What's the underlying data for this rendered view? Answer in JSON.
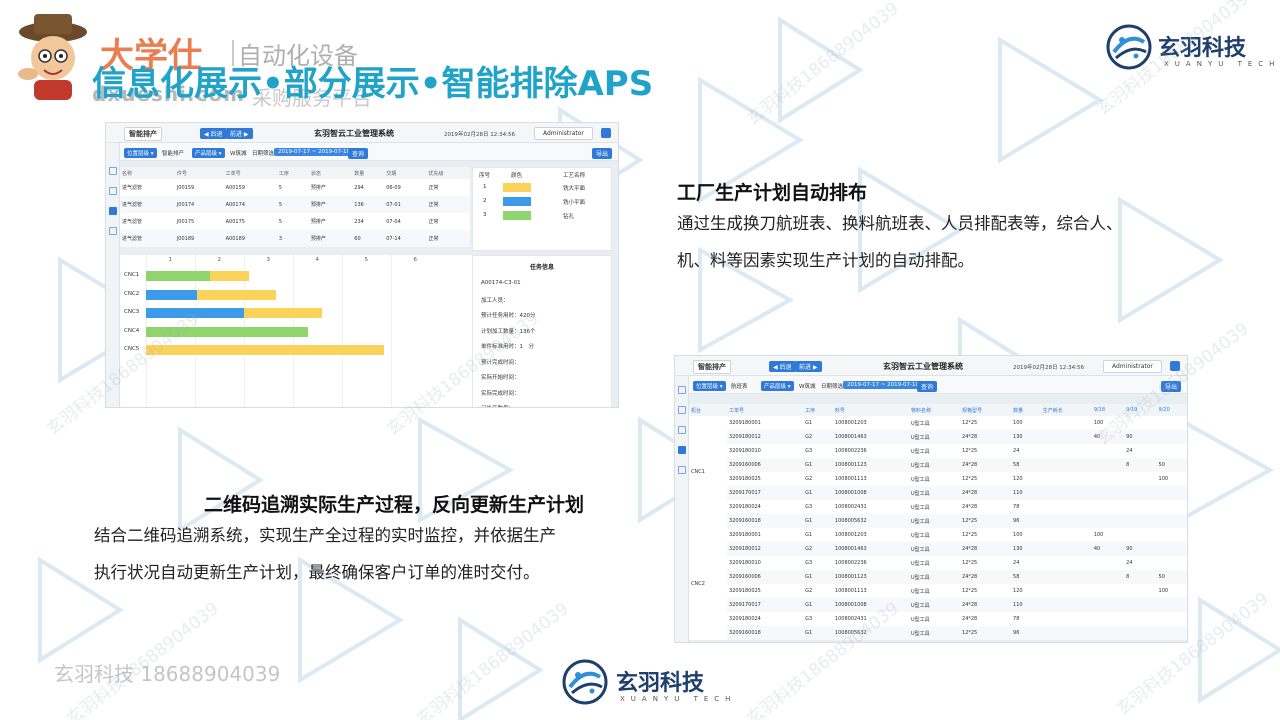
{
  "header": {
    "brand_name": "大学仕",
    "brand_sub": "自动化设备",
    "brand_url": "dxueshi.com",
    "brand_url_sub": "采购服务平台",
    "title": "信息化展示•部分展示•智能排除APS"
  },
  "logo": {
    "name": "玄羽科技",
    "sub": "XUANYU TECH",
    "primary_color": "#1e3f6d",
    "accent_color": "#2f8fd8"
  },
  "accent_color": "#1fa3c9",
  "screen1": {
    "menu_label": "智能排产",
    "nav_prev": "◀ 后退",
    "nav_next": "前进 ▶",
    "app_title": "玄羽智云工业管理系统",
    "datetime": "2019年02月28日  12:34:56",
    "user": "Administrator",
    "filter_dropdown": "位置层级 ▾",
    "breadcrumb_1": "智能排产",
    "filter_product": "产品层级 ▾",
    "filter_w": "W筑城",
    "date_label": "日期筛选",
    "date_range": "2019-07-17 ~ 2019-07-18",
    "query_btn": "查询",
    "export_btn": "导出",
    "table_headers": [
      "名称",
      "件号",
      "工单号",
      "工序",
      "状态",
      "数量",
      "交期",
      "优先级"
    ],
    "table_rows": [
      [
        "进气滤管",
        "J00159",
        "A00159",
        "5",
        "预排产",
        "294",
        "06-09",
        "正常"
      ],
      [
        "进气滤管",
        "J00174",
        "A00174",
        "5",
        "预排产",
        "136",
        "07-01",
        "正常"
      ],
      [
        "进气滤管",
        "J00175",
        "A00175",
        "5",
        "预排产",
        "234",
        "07-04",
        "正常"
      ],
      [
        "进气滤管",
        "J00189",
        "A00189",
        "3",
        "预排产",
        "60",
        "07-14",
        "正常"
      ]
    ],
    "legend_headers": [
      "序号",
      "颜色",
      "工艺名称"
    ],
    "legend_rows": [
      {
        "no": "1",
        "color": "#fbd35a",
        "name": "铣大平面"
      },
      {
        "no": "2",
        "color": "#3d9be9",
        "name": "铣小平面"
      },
      {
        "no": "3",
        "color": "#8fd46c",
        "name": "钻孔"
      }
    ],
    "gantt_ticks": [
      "1",
      "2",
      "3",
      "4",
      "5",
      "6"
    ],
    "gantt_rows": [
      {
        "label": "CNC1",
        "segments": [
          {
            "start": 0,
            "len": 1.3,
            "color": "#8fd46c"
          },
          {
            "start": 1.3,
            "len": 0.8,
            "color": "#fbd35a"
          }
        ]
      },
      {
        "label": "CNC2",
        "segments": [
          {
            "start": 0,
            "len": 1.05,
            "color": "#3d9be9"
          },
          {
            "start": 1.05,
            "len": 1.6,
            "color": "#fbd35a"
          }
        ]
      },
      {
        "label": "CNC3",
        "segments": [
          {
            "start": 0,
            "len": 2.0,
            "color": "#3d9be9"
          },
          {
            "start": 2.0,
            "len": 1.6,
            "color": "#fbd35a"
          }
        ]
      },
      {
        "label": "CNC4",
        "segments": [
          {
            "start": 0,
            "len": 3.3,
            "color": "#8fd46c"
          }
        ]
      },
      {
        "label": "CNC5",
        "segments": [
          {
            "start": 0,
            "len": 4.85,
            "color": "#fbd35a"
          }
        ]
      }
    ],
    "task_title": "任务信息",
    "task_lines": [
      "A00174-C3-01",
      "加工人员：",
      "预计任务用时：420分",
      "计划加工数量：136个",
      "单件标准用时：1　分",
      "预计完成时间：",
      "实际开始时间：",
      "实际完成时间：",
      "已生产数量："
    ]
  },
  "screen2": {
    "menu_label": "智能排产",
    "nav_prev": "◀ 后退",
    "nav_next": "前进 ▶",
    "app_title": "玄羽智云工业管理系统",
    "datetime": "2019年02月28日  12:34:56",
    "user": "Administrator",
    "filter_dropdown": "位置层级 ▾",
    "breadcrumb_1": "航班表",
    "filter_product": "产品层级 ▾",
    "filter_w": "W筑城",
    "date_label": "日期筛选",
    "date_range": "2019-07-17 ~ 2019-07-18",
    "query_btn": "查询",
    "export_btn": "导出",
    "table_headers": [
      "机台",
      "工单号",
      "工序",
      "料号",
      "物料名称",
      "规格型号",
      "数量",
      "生产耗长",
      "9/18",
      "9/19",
      "9/20"
    ],
    "machines": [
      "CNC1",
      "CNC2"
    ],
    "rows": [
      [
        "3209180001",
        "G1",
        "1008001203",
        "U型工具",
        "12*25",
        "100",
        "",
        "100",
        "",
        ""
      ],
      [
        "3209180012",
        "G2",
        "1008001463",
        "U型工具",
        "24*28",
        "130",
        "",
        "40",
        "90",
        ""
      ],
      [
        "3209180010",
        "G3",
        "1008002236",
        "U型工具",
        "12*25",
        "24",
        "",
        "",
        "24",
        ""
      ],
      [
        "3209160006",
        "G1",
        "1008001123",
        "U型工具",
        "24*28",
        "58",
        "",
        "",
        "8",
        "50"
      ],
      [
        "3209180025",
        "G2",
        "1008001113",
        "U型工具",
        "12*25",
        "120",
        "",
        "",
        "",
        "100"
      ],
      [
        "3209170017",
        "G1",
        "1008001008",
        "U型工具",
        "24*28",
        "110",
        "",
        "",
        "",
        ""
      ],
      [
        "3209180024",
        "G3",
        "1008002431",
        "U型工具",
        "24*28",
        "78",
        "",
        "",
        "",
        ""
      ],
      [
        "3209160018",
        "G1",
        "1008005632",
        "U型工具",
        "12*25",
        "96",
        "",
        "",
        "",
        ""
      ],
      [
        "3209180001",
        "G1",
        "1008001203",
        "U型工具",
        "12*25",
        "100",
        "",
        "100",
        "",
        ""
      ],
      [
        "3209180012",
        "G2",
        "1008001463",
        "U型工具",
        "24*28",
        "130",
        "",
        "40",
        "90",
        ""
      ],
      [
        "3209180010",
        "G3",
        "1008002236",
        "U型工具",
        "12*25",
        "24",
        "",
        "",
        "24",
        ""
      ],
      [
        "3209160006",
        "G1",
        "1008001123",
        "U型工具",
        "24*28",
        "58",
        "",
        "",
        "8",
        "50"
      ],
      [
        "3209180025",
        "G2",
        "1008001113",
        "U型工具",
        "12*25",
        "120",
        "",
        "",
        "",
        "100"
      ],
      [
        "3209170017",
        "G1",
        "1008001008",
        "U型工具",
        "24*28",
        "110",
        "",
        "",
        "",
        ""
      ],
      [
        "3209180024",
        "G3",
        "1008002431",
        "U型工具",
        "24*28",
        "78",
        "",
        "",
        "",
        ""
      ],
      [
        "3209160018",
        "G1",
        "1008005632",
        "U型工具",
        "12*25",
        "96",
        "",
        "",
        "",
        ""
      ]
    ]
  },
  "section1": {
    "title": "工厂生产计划自动排布",
    "line1": "通过生成换刀航班表、换料航班表、人员排配表等，综合人、",
    "line2": "机、料等因素实现生产计划的自动排配。"
  },
  "section2": {
    "title": "二维码追溯实际生产过程，反向更新生产计划",
    "line1": "结合二维码追溯系统，实现生产全过程的实时监控，并依据生产",
    "line2": "执行状况自动更新生产计划，最终确保客户订单的准时交付。"
  },
  "footer": {
    "watermark": "玄羽科技  18688904039"
  },
  "watermarks": [
    "玄羽科技18688904039"
  ]
}
